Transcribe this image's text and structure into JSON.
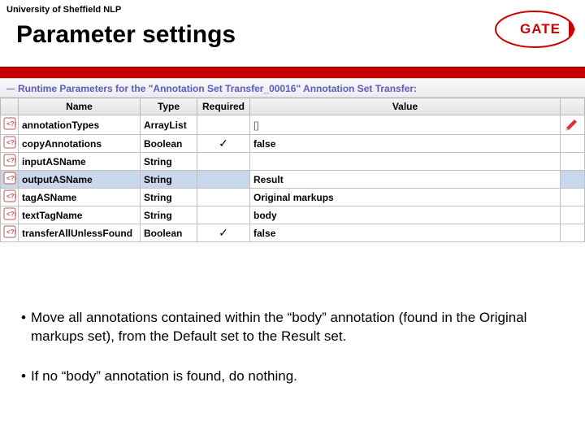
{
  "header": {
    "university": "University of Sheffield NLP",
    "title": "Parameter settings",
    "logo_text": "GATE"
  },
  "panel": {
    "title": "Runtime Parameters for the \"Annotation Set Transfer_00016\" Annotation Set Transfer:"
  },
  "columns": {
    "name": "Name",
    "type": "Type",
    "required": "Required",
    "value": "Value"
  },
  "rows": [
    {
      "name": "annotationTypes",
      "type": "ArrayList",
      "required": "",
      "value": "[]",
      "editable": true,
      "selected": false
    },
    {
      "name": "copyAnnotations",
      "type": "Boolean",
      "required": "✓",
      "value": "false",
      "editable": false,
      "selected": false
    },
    {
      "name": "inputASName",
      "type": "String",
      "required": "",
      "value": "",
      "editable": false,
      "selected": false
    },
    {
      "name": "outputASName",
      "type": "String",
      "required": "",
      "value": "Result",
      "editable": false,
      "selected": true
    },
    {
      "name": "tagASName",
      "type": "String",
      "required": "",
      "value": "Original markups",
      "editable": false,
      "selected": false
    },
    {
      "name": "textTagName",
      "type": "String",
      "required": "",
      "value": "body",
      "editable": false,
      "selected": false
    },
    {
      "name": "transferAllUnlessFound",
      "type": "Boolean",
      "required": "✓",
      "value": "false",
      "editable": false,
      "selected": false
    }
  ],
  "notes": {
    "n1": "Move all annotations contained within the “body” annotation (found in the Original markups set), from the Default set to the Result set.",
    "n2": "If no “body” annotation is found, do nothing."
  }
}
